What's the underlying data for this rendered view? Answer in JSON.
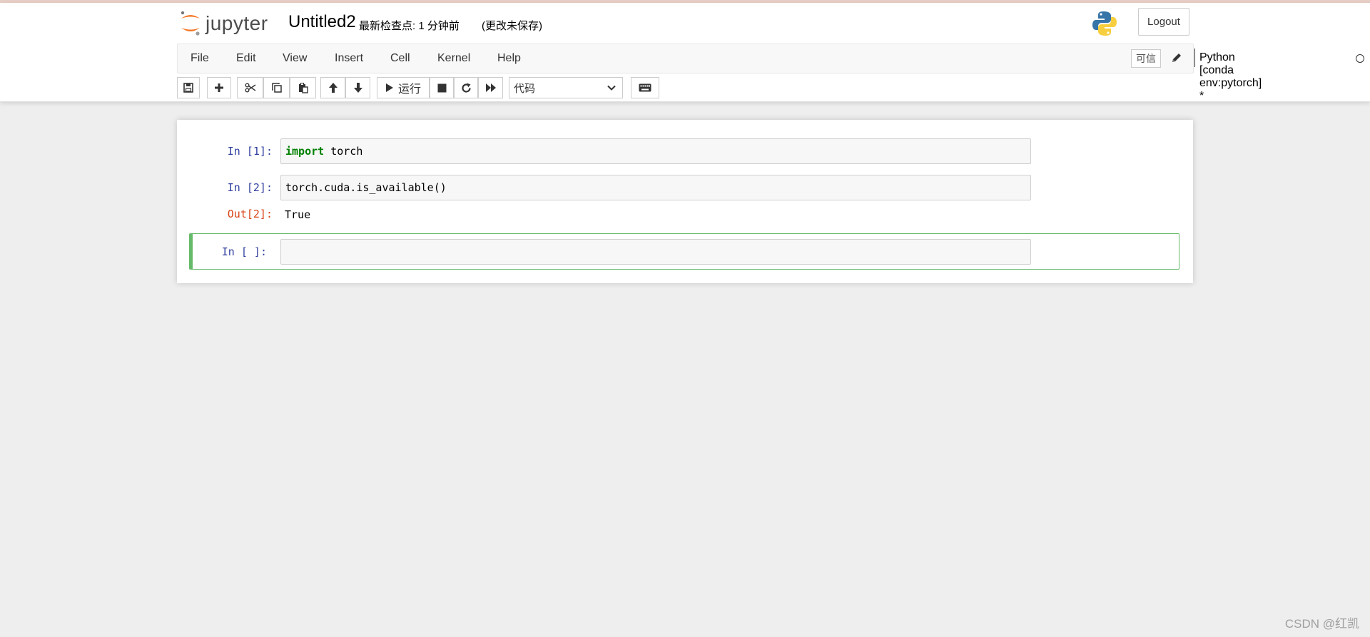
{
  "header": {
    "logo_text": "jupyter",
    "notebook_name": "Untitled2",
    "checkpoint": "最新检查点: 1 分钟前",
    "autosave_status": "(更改未保存)",
    "logout_label": "Logout"
  },
  "menubar": {
    "items": [
      "File",
      "Edit",
      "View",
      "Insert",
      "Cell",
      "Kernel",
      "Help"
    ],
    "trusted_label": "可信",
    "kernel_name": "Python [conda env:pytorch] *"
  },
  "toolbar": {
    "run_label": "运行",
    "cell_type": "代码",
    "icons": [
      "save-icon",
      "plus-icon",
      "cut-icon",
      "copy-icon",
      "paste-icon",
      "arrow-up-icon",
      "arrow-down-icon",
      "play-icon",
      "stop-icon",
      "restart-icon",
      "fast-forward-icon",
      "keyboard-icon"
    ]
  },
  "cells": [
    {
      "prompt": "In  [1]:",
      "code_keyword": "import",
      "code_rest": " torch"
    },
    {
      "prompt": "In  [2]:",
      "code": "torch.cuda.is_available()",
      "out_prompt": "Out[2]:",
      "output": "True"
    },
    {
      "prompt": "In  [ ]:",
      "code": ""
    }
  ],
  "colors": {
    "accent_orange": "#f37726",
    "prompt_in": "#303f9f",
    "prompt_out": "#d84315",
    "selected_border": "#66bb6a",
    "keyword": "#008000"
  },
  "watermark": "CSDN @红凯"
}
